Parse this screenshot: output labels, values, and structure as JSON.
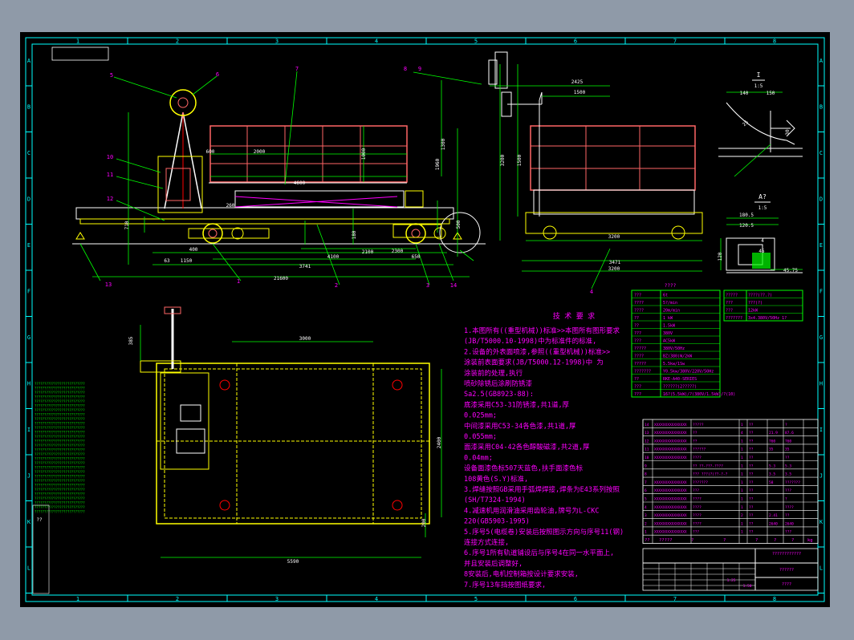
{
  "colors": {
    "background": "#000000",
    "page": "#8f9aa8",
    "frame": "#00ffff",
    "text": "#ff00ff",
    "structure": "#ffff00",
    "dimension": "#00ff00",
    "body": "#ffffff",
    "rail": "#ff6666"
  },
  "border": {
    "columns": [
      "1",
      "2",
      "3",
      "4",
      "5",
      "6",
      "7",
      "8"
    ],
    "rows": [
      "A",
      "B",
      "C",
      "D",
      "E",
      "F",
      "G",
      "H",
      "I",
      "J",
      "K",
      "L"
    ]
  },
  "side_view": {
    "callouts": [
      "5",
      "6",
      "7",
      "8",
      "9",
      "10",
      "11",
      "12",
      "13",
      "1",
      "2",
      "3",
      "14"
    ],
    "dims": [
      "2000",
      "4600",
      "1000",
      "1300",
      "710",
      "600",
      "260",
      "400",
      "4100",
      "2100",
      "3741",
      "1150",
      "63",
      "21600",
      "650",
      "180",
      "2300",
      "500",
      "1960"
    ]
  },
  "end_view": {
    "callouts": [
      "4"
    ],
    "dims": [
      "2425",
      "1500",
      "3200",
      "3200",
      "3471",
      "3200",
      "1500"
    ]
  },
  "detail_view": {
    "title_1": "I",
    "scale_1": "1:5",
    "title_2": "A?",
    "scale_2": "1:5",
    "dims": [
      "140",
      "150",
      "25",
      "30",
      "180.5",
      "120.5",
      "4",
      "45",
      "45.75",
      "120"
    ]
  },
  "plan_view": {
    "dims": [
      "3000",
      "2400",
      "5590",
      "385",
      "200"
    ]
  },
  "notes": {
    "title": "技 术 要 求",
    "lines": [
      "1.本图所有((重型机械))标准>>本图所有图形要求",
      "(JB/T5000.10-1998)中为标准件的标准,",
      "2.设备的外表面喷漆,参照((重型机械))标准>>",
      "涂装前表面要求(JB/T5000.12-1998)中  为",
      "涂装前的处理,执行",
      "  喷砂除锈后涂刷防锈漆",
      "Sa2.5(GB8923-88):",
      "  底漆采用C53-31防锈漆,共1道,厚",
      "0.025mm;",
      "  中间漆采用C53-34各色漆,共1道,厚",
      "0.055mm;",
      "  面漆采用C04-42各色醇酸磁漆,共2道,厚",
      "0.04mm;",
      "  设备面漆色标507天蓝色,扶手面漆色标",
      "108黄色(S.Y)标准,",
      "3.焊缝按照GB采用手弧焊焊接,焊条为E43系列按照",
      "(SH/T7324-1994)",
      "4.减速机用润滑油采用齿轮油,牌号为L-CKC",
      "220(GB5903-1995)",
      "5.序号5(电缆卷)安装后按照图示方向与序号11(钢)",
      "连接方式连接,",
      "6.序号1所有轨道铺设后与序号4在同一水平面上,",
      "并且安装后调整好,",
      "  8安装后,电机控制箱按设计要求安装,",
      "7.序号13车挡按图纸要求,"
    ]
  },
  "spec_table": {
    "title": "????",
    "rows": [
      [
        "???",
        "6t"
      ],
      [
        "????",
        "5?/min"
      ],
      [
        "????",
        "20m/min"
      ],
      [
        "??",
        "1 kW"
      ],
      [
        "??",
        "1.5kW"
      ],
      [
        "???",
        "380V"
      ],
      [
        "???",
        "AC5kW"
      ],
      [
        "?????",
        "380V/50Hz"
      ],
      [
        "????",
        "BZ(380)W/2kW"
      ],
      [
        "?????",
        "5.5kw/1Sw"
      ],
      [
        "???????",
        "Y0.5kw/380V/220V/50Hz"
      ],
      [
        "??",
        "RKE-A40-SERIES"
      ],
      [
        "???",
        "??????(2?????)"
      ],
      [
        "???",
        "16?(5.5kW)/?(380V/1.5kW)/?(10)"
      ]
    ]
  },
  "spec_table_2": {
    "rows": [
      [
        "?????",
        "????(??.?)"
      ],
      [
        "???",
        "???(?)"
      ],
      [
        "???",
        "12kW"
      ],
      [
        "???????",
        "3x4.380V/50Hz 1?"
      ]
    ]
  },
  "bom": {
    "rows": [
      [
        "14",
        "XXXXXXXXXXXXXXX",
        "?????",
        "1",
        "??",
        "",
        "?"
      ],
      [
        "13",
        "XXXXXXXXXXXXXXX",
        "??",
        "4",
        "??",
        "21.9",
        "87.6"
      ],
      [
        "12",
        "XXXXXXXXXXXXXXX",
        "??",
        "1",
        "??",
        "760",
        "760"
      ],
      [
        "11",
        "XXXXXXXXXXXXXXX",
        "??????",
        "1",
        "??",
        "35",
        "35"
      ],
      [
        "10",
        "XXXXXXXXXXXXXXX",
        "????",
        "1",
        "??",
        "",
        "??"
      ],
      [
        "9",
        "",
        "?? ??-???-????",
        "1",
        "??",
        "5.3",
        "5.3"
      ],
      [
        "8",
        "",
        "??? ???(?)??-?-?",
        "1",
        "??",
        "3.5",
        "3.5"
      ],
      [
        "7",
        "XXXXXXXXXXXXXXX",
        "???????",
        "1",
        "??",
        "58",
        "???????"
      ],
      [
        "6",
        "XXXXXXXXXXXXXXX",
        "???",
        "1",
        "??",
        "",
        "???"
      ],
      [
        "5",
        "XXXXXXXXXXXXXXX",
        "????",
        "1",
        "??",
        "",
        "?"
      ],
      [
        "4",
        "XXXXXXXXXXXXXXX",
        "????",
        "1",
        "??",
        "",
        "????"
      ],
      [
        "3",
        "XXXXXXXXXXXXXXX",
        "????",
        "2",
        "??",
        "2.41",
        "??"
      ],
      [
        "2",
        "XXXXXXXXXXXXXXX",
        "????",
        "1",
        "??",
        "2640",
        "2640"
      ],
      [
        "1",
        "XXXXXXXXXXXXXXX",
        "???",
        "1",
        "??",
        "",
        "???"
      ]
    ],
    "header": [
      "??",
      "?????",
      "?",
      "?",
      "?",
      "?",
      "?",
      "kg"
    ]
  },
  "title_block": {
    "company": "????????????",
    "drawing_name": "??????",
    "weight": "????",
    "scale": "1:25",
    "qty": "1:50"
  },
  "side_notes": {
    "left_column": "??????????????????????????????????????????????",
    "left_bottom": "??"
  }
}
